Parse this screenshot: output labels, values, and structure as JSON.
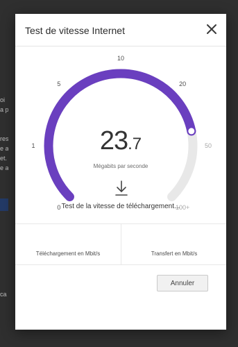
{
  "dialog": {
    "title": "Test de vitesse Internet",
    "close_icon": "close-icon"
  },
  "gauge": {
    "value_int": "23",
    "value_dec": ".7",
    "value": 23.7,
    "unit": "Mégabits par seconde",
    "progress_fraction": 0.79,
    "accent_color": "#6a3fbf",
    "track_color": "#e8e8e8",
    "ticks": [
      "0",
      "1",
      "5",
      "10",
      "20",
      "50",
      "100+"
    ],
    "status": "Test de la vitesse de téléchargement...",
    "download_icon": "download-arrow-icon"
  },
  "results": {
    "download_label": "Téléchargement en Mbit/s",
    "upload_label": "Transfert en Mbit/s"
  },
  "actions": {
    "cancel_label": "Annuler"
  }
}
